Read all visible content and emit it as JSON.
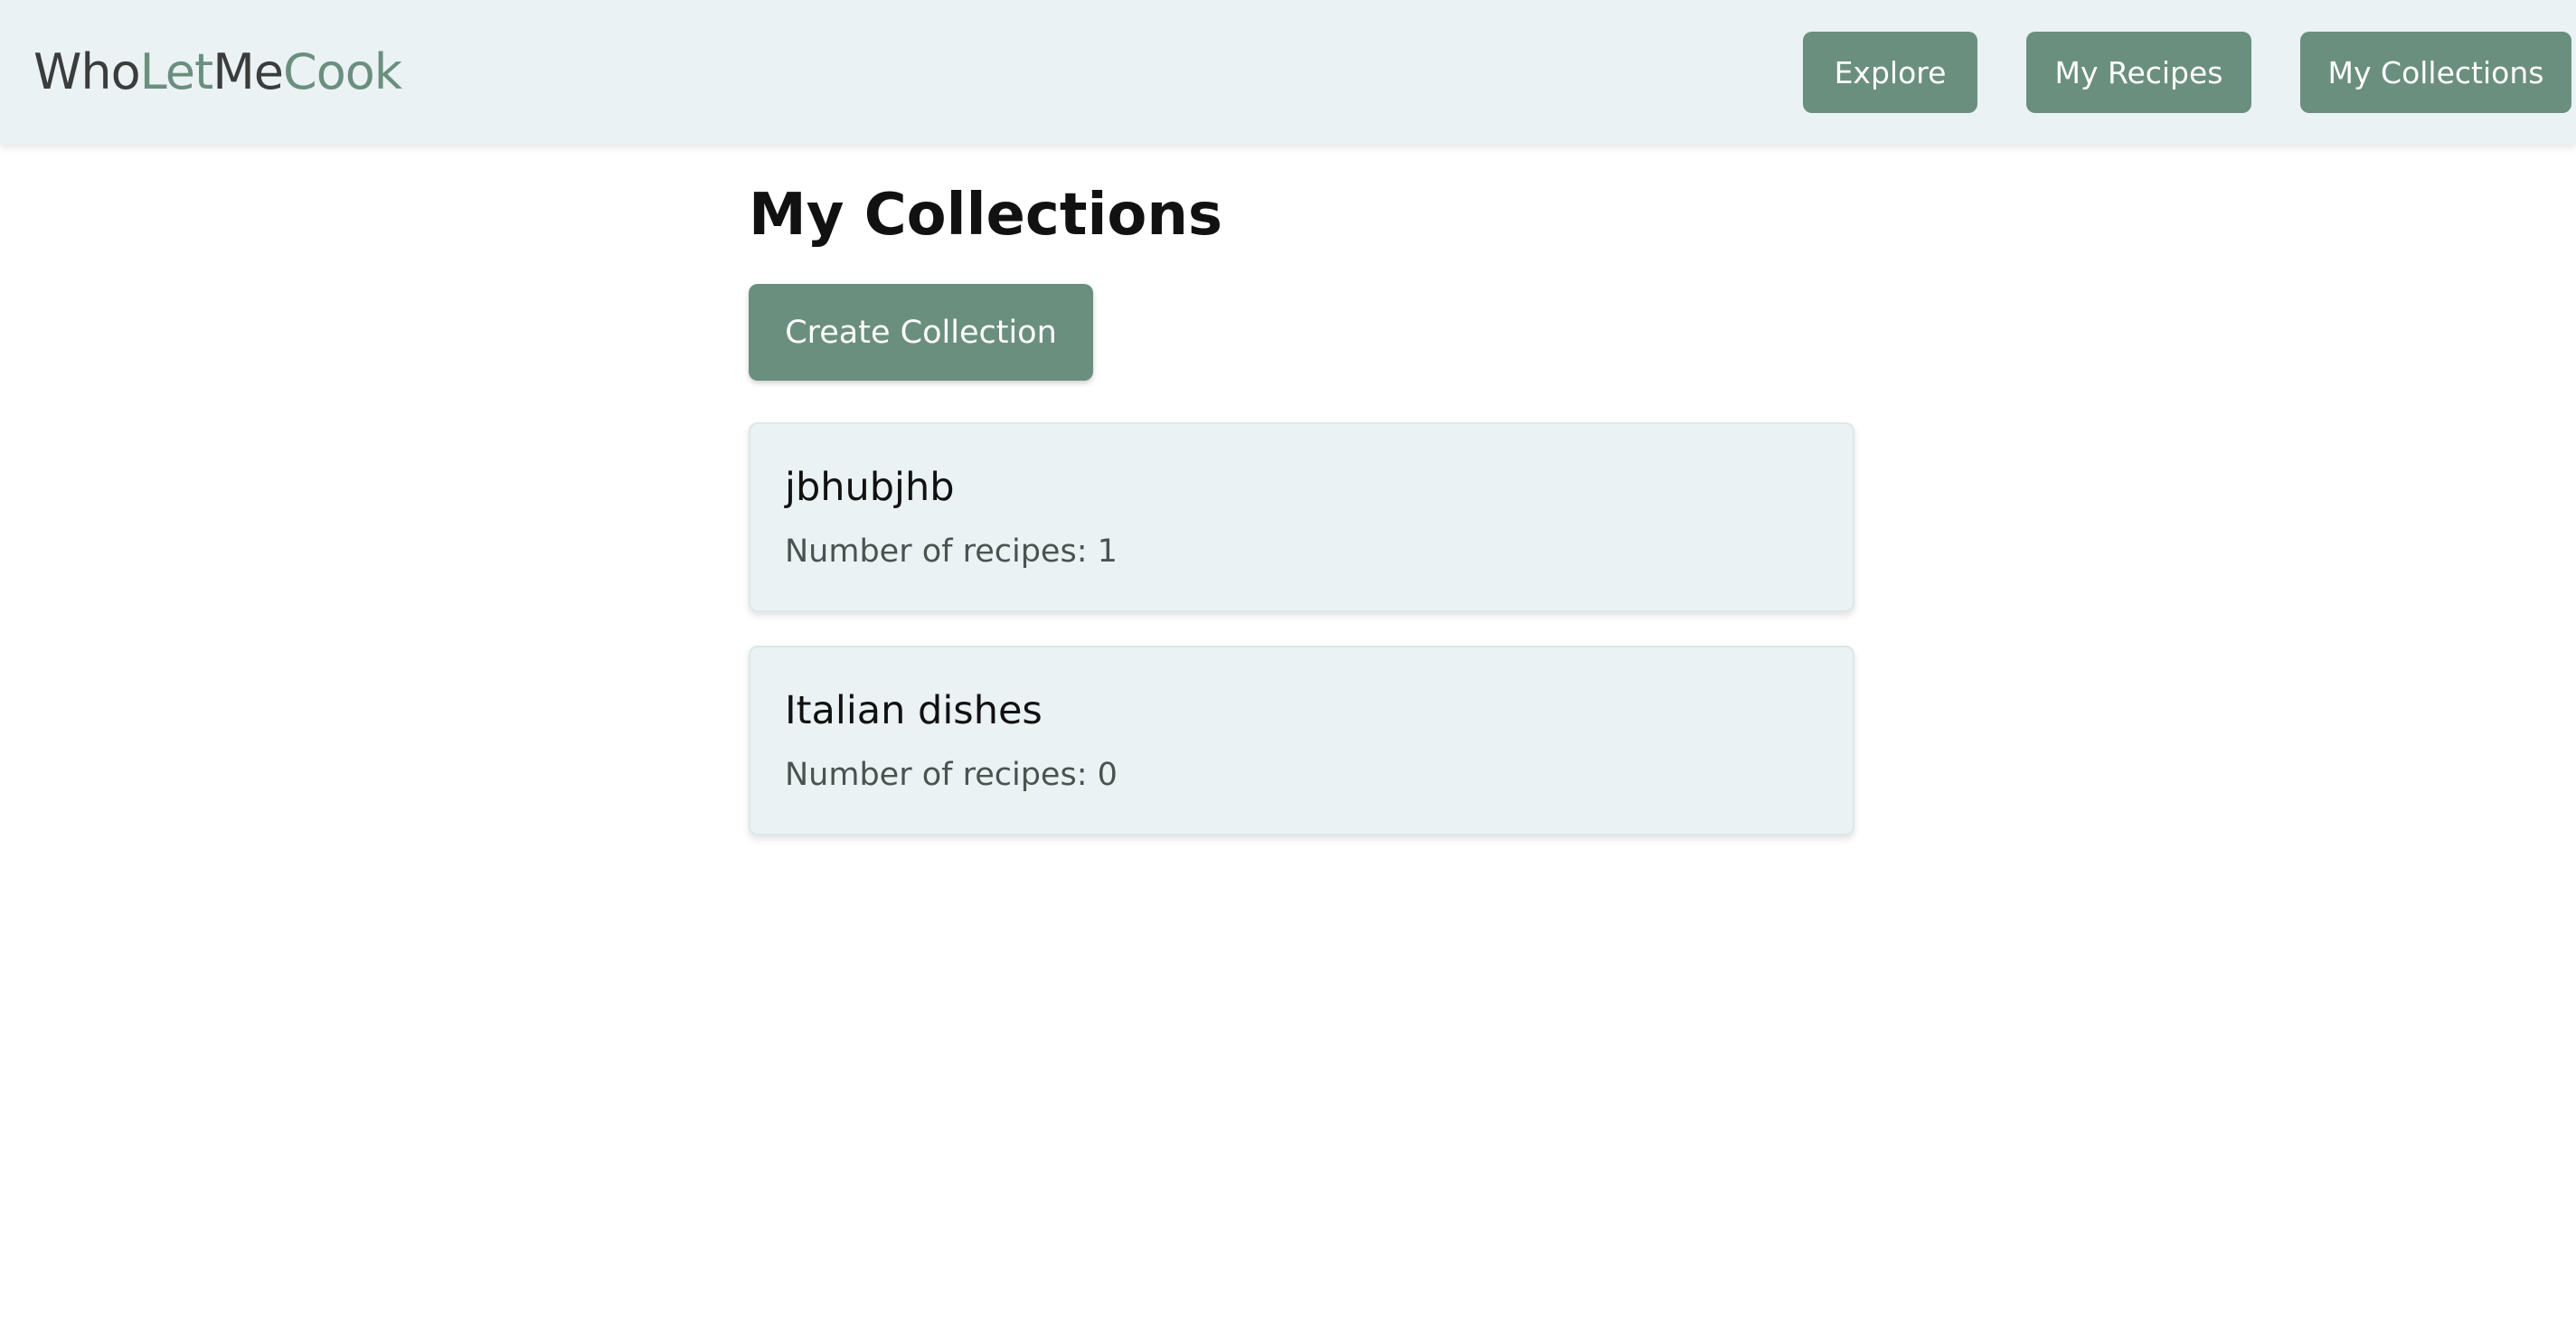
{
  "header": {
    "logo": {
      "part1": "Who",
      "part2": "Let",
      "part3": "Me",
      "part4": "Cook"
    },
    "nav": [
      {
        "label": "Explore"
      },
      {
        "label": "My Recipes"
      },
      {
        "label": "My Collections"
      }
    ]
  },
  "main": {
    "title": "My Collections",
    "create_button_label": "Create Collection",
    "collections": [
      {
        "name": "jbhubjhb",
        "count_text": "Number of recipes: 1"
      },
      {
        "name": "Italian dishes",
        "count_text": "Number of recipes: 0"
      }
    ]
  },
  "colors": {
    "accent": "#6b8f7f",
    "header_bg": "#eaf2f3",
    "card_bg": "#eaf2f3",
    "logo_dark": "#3a3d3b"
  }
}
